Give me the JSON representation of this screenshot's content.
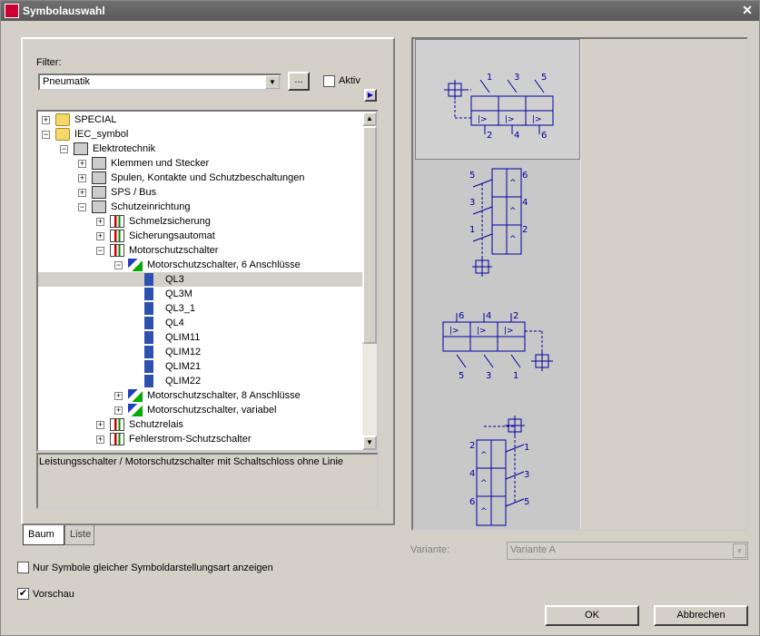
{
  "window": {
    "title": "Symbolauswahl"
  },
  "filter": {
    "label": "Filter:",
    "value": "Pneumatik",
    "browse_label": "...",
    "active_label": "Aktiv",
    "active_checked": false
  },
  "tree": {
    "rows": [
      {
        "text": "SPECIAL",
        "level": 0,
        "icon": "folder-icon",
        "expander": "+"
      },
      {
        "text": "IEC_symbol",
        "level": 0,
        "icon": "folder-icon",
        "expander": "−"
      },
      {
        "text": "Elektrotechnik",
        "level": 1,
        "icon": "book-icon",
        "expander": "−"
      },
      {
        "text": "Klemmen und Stecker",
        "level": 2,
        "icon": "book-icon",
        "expander": "+"
      },
      {
        "text": "Spulen, Kontakte und Schutzbeschaltungen",
        "level": 2,
        "icon": "book-icon",
        "expander": "+"
      },
      {
        "text": "SPS / Bus",
        "level": 2,
        "icon": "book-icon",
        "expander": "+"
      },
      {
        "text": "Schutzeinrichtung",
        "level": 2,
        "icon": "book-icon",
        "expander": "−"
      },
      {
        "text": "Schmelzsicherung",
        "level": 3,
        "icon": "symbol-group-icon",
        "expander": "+"
      },
      {
        "text": "Sicherungsautomat",
        "level": 3,
        "icon": "symbol-group-icon",
        "expander": "+"
      },
      {
        "text": "Motorschutzschalter",
        "level": 3,
        "icon": "symbol-group-icon",
        "expander": "−"
      },
      {
        "text": "Motorschutzschalter, 6 Anschlüsse",
        "level": 4,
        "icon": "shapes-icon",
        "expander": "−"
      },
      {
        "text": "QL3",
        "level": 5,
        "icon": "plug-icon",
        "expander": "",
        "selected": true
      },
      {
        "text": "QL3M",
        "level": 5,
        "icon": "plug-icon",
        "expander": ""
      },
      {
        "text": "QL3_1",
        "level": 5,
        "icon": "plug-icon",
        "expander": ""
      },
      {
        "text": "QL4",
        "level": 5,
        "icon": "plug-icon",
        "expander": ""
      },
      {
        "text": "QLIM11",
        "level": 5,
        "icon": "plug-icon",
        "expander": ""
      },
      {
        "text": "QLIM12",
        "level": 5,
        "icon": "plug-icon",
        "expander": ""
      },
      {
        "text": "QLIM21",
        "level": 5,
        "icon": "plug-icon",
        "expander": ""
      },
      {
        "text": "QLIM22",
        "level": 5,
        "icon": "plug-icon",
        "expander": ""
      },
      {
        "text": "Motorschutzschalter, 8 Anschlüsse",
        "level": 4,
        "icon": "shapes-icon",
        "expander": "+"
      },
      {
        "text": "Motorschutzschalter, variabel",
        "level": 4,
        "icon": "shapes-icon",
        "expander": "+"
      },
      {
        "text": "Schutzrelais",
        "level": 3,
        "icon": "symbol-group-icon",
        "expander": "+"
      },
      {
        "text": "Fehlerstrom-Schutzschalter",
        "level": 3,
        "icon": "symbol-group-icon",
        "expander": "+"
      }
    ]
  },
  "description": "Leistungsschalter / Motorschutzschalter mit Schaltschloss ohne Linie",
  "tabs": [
    {
      "label": "Baum",
      "active": true
    },
    {
      "label": "Liste",
      "active": false
    }
  ],
  "preview": {
    "labels": {
      "v1": [
        "1",
        "3",
        "5",
        "2",
        "4",
        "6"
      ],
      "v2": [
        "5",
        "6",
        "3",
        "4",
        "1",
        "2"
      ],
      "v3": [
        "6",
        "4",
        "2",
        "5",
        "3",
        "1"
      ],
      "v4": [
        "2",
        "1",
        "4",
        "3",
        "6",
        "5"
      ]
    }
  },
  "variant": {
    "label": "Variante:",
    "value": "Variante A"
  },
  "options": {
    "same_style_label": "Nur Symbole gleicher Symboldarstellungsart anzeigen",
    "same_style_checked": false,
    "preview_label": "Vorschau",
    "preview_checked": true,
    "check_mark": "✔"
  },
  "buttons": {
    "ok": "OK",
    "cancel": "Abbrechen"
  }
}
